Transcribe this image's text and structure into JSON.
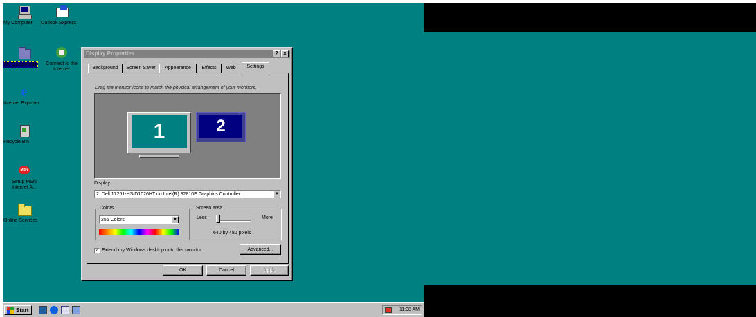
{
  "desktop_icons": [
    {
      "label": "My Computer",
      "icon": "computer-icon"
    },
    {
      "label": "Outlook Express",
      "icon": "outlook-express-icon"
    },
    {
      "label": "My Documents",
      "icon": "my-documents-icon"
    },
    {
      "label": "Connect to the Internet",
      "icon": "connect-internet-icon"
    },
    {
      "label": "Internet Explorer",
      "icon": "internet-explorer-icon"
    },
    {
      "label": "Recycle Bin",
      "icon": "recycle-bin-icon"
    },
    {
      "label": "Setup MSN Internet A...",
      "icon": "msn-setup-icon"
    },
    {
      "label": "Online Services",
      "icon": "folder-icon"
    }
  ],
  "dialog": {
    "title": "Display Properties",
    "help_btn": "?",
    "close_btn": "×",
    "tabs": [
      "Background",
      "Screen Saver",
      "Appearance",
      "Effects",
      "Web",
      "Settings"
    ],
    "active_tab": "Settings",
    "instruction": "Drag the monitor icons to match the physical arrangement of your monitors.",
    "monitor1_number": "1",
    "monitor2_number": "2",
    "display_label": "Display:",
    "display_value": "2. Dell 17261-HS/D1026HT on Intel(R) 82810E Graphics Controller",
    "colors_label": "Colors",
    "colors_value": "256 Colors",
    "screen_area_label": "Screen area",
    "screen_area_less": "Less",
    "screen_area_more": "More",
    "screen_area_value": "640 by 480 pixels",
    "extend_label": "Extend my Windows desktop onto this monitor.",
    "extend_checked": "✓",
    "advanced_btn": "Advanced...",
    "ok_btn": "OK",
    "cancel_btn": "Cancel",
    "apply_btn": "Apply"
  },
  "taskbar": {
    "start_label": "Start",
    "clock": "11:08 AM"
  },
  "colors": {
    "desktop": "#008080",
    "title_inactive": "#808080",
    "face": "#c0c0c0"
  }
}
